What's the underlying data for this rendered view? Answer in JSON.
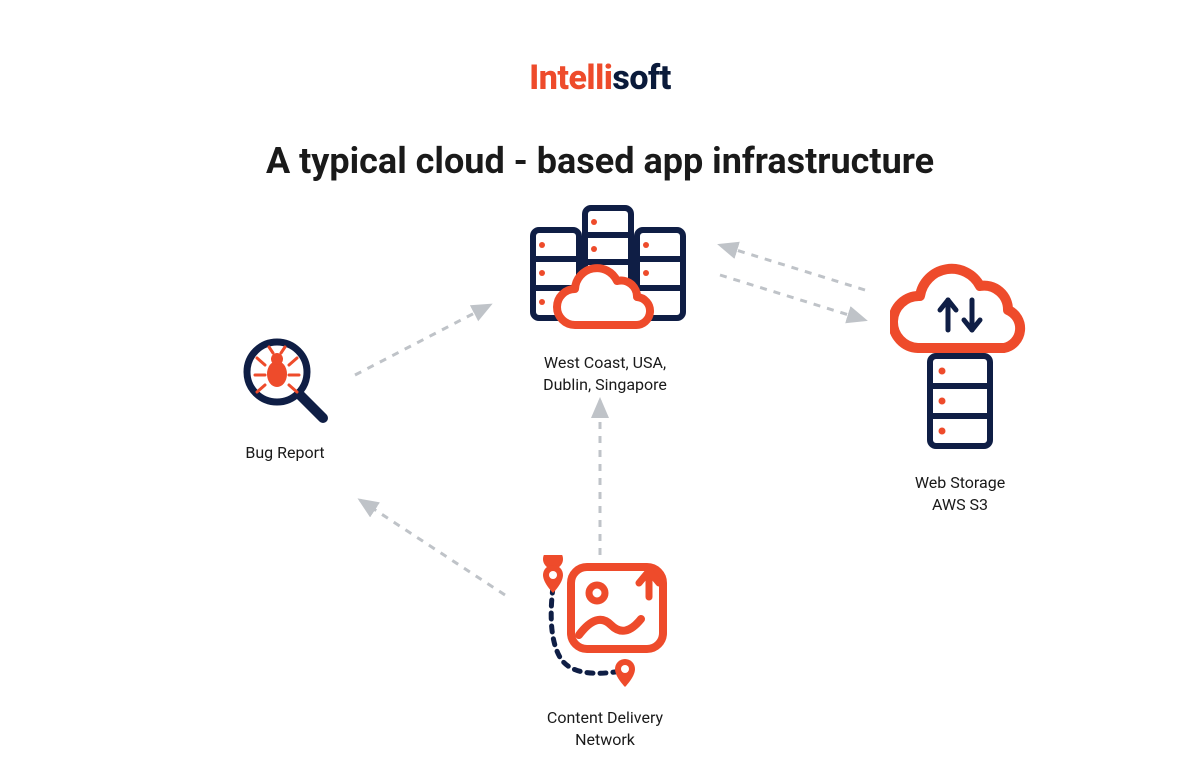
{
  "logo": {
    "part1": "Intelli",
    "part2": "soft"
  },
  "title": "A typical cloud - based app infrastructure",
  "nodes": {
    "bug": {
      "label": "Bug Report"
    },
    "servers": {
      "label": "West Coast, USA,\nDublin, Singapore"
    },
    "storage": {
      "label": "Web Storage\nAWS S3"
    },
    "cdn": {
      "label": "Content Delivery\nNetwork"
    }
  },
  "colors": {
    "accent": "#ee4b2b",
    "dark": "#0f1e45",
    "arrow": "#bfc3c8"
  },
  "arrows": [
    {
      "from": "bug",
      "to": "servers",
      "bidir": false
    },
    {
      "from": "servers",
      "to": "storage",
      "bidir": true
    },
    {
      "from": "cdn",
      "to": "servers",
      "bidir": false
    },
    {
      "from": "cdn",
      "to": "bug",
      "bidir": false
    }
  ]
}
